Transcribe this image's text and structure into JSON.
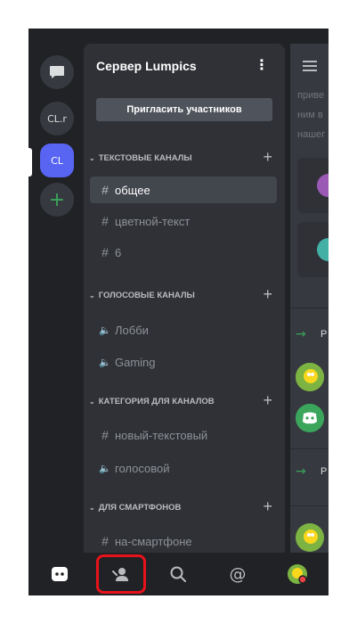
{
  "servers": [
    {
      "label": "",
      "icon": "chat-bubble-icon"
    },
    {
      "label": "CL.r"
    },
    {
      "label": "CL",
      "active": true
    },
    {
      "label": "+",
      "icon": "plus-icon"
    }
  ],
  "server_name": "Сервер Lumpics",
  "invite_label": "Пригласить участников",
  "categories": {
    "text": "ТЕКСТОВЫЕ КАНАЛЫ",
    "voice": "ГОЛОСОВЫЕ КАНАЛЫ",
    "custom": "КАТЕГОРИЯ ДЛЯ КАНАЛОВ",
    "phones": "ДЛЯ СМАРТФОНОВ"
  },
  "channels": {
    "general": "общее",
    "color_text": "цветной-текст",
    "six": "6",
    "lobby": "Лобби",
    "gaming": "Gaming",
    "new_text": "новый-текстовый",
    "voice": "голосовой",
    "phone": "на-смартфоне"
  },
  "chat_preview": {
    "lines": [
      "приве",
      "ним в",
      "нашег"
    ],
    "p1": "Р",
    "p2": "Р"
  },
  "colors": {
    "accent": "#5865f2",
    "highlight_box": "#e8121b",
    "join_arrow": "#3ba55c"
  }
}
